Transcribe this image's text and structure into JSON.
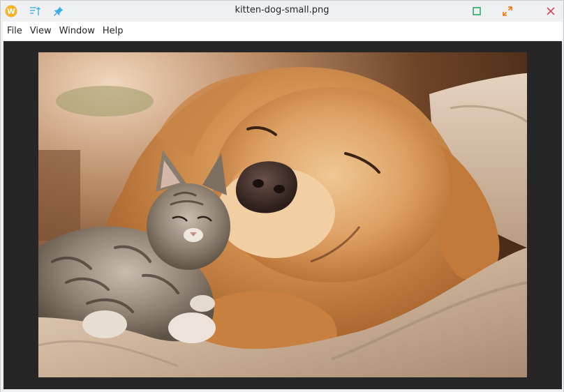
{
  "window": {
    "title": "kitten-dog-small.png"
  },
  "titlebar": {
    "app_icon": "app-logo-icon",
    "sort_icon": "sort-icon",
    "pin_icon": "pin-icon",
    "maximize_icon": "maximize-icon",
    "restore_icon": "restore-icon",
    "close_icon": "close-icon",
    "colors": {
      "app_logo": "#f5b324",
      "accent_blue": "#3daee9",
      "maximize_green": "#27ae60",
      "restore_orange": "#f67400",
      "close_red": "#da4453"
    }
  },
  "menu": {
    "items": [
      {
        "label": "File"
      },
      {
        "label": "View"
      },
      {
        "label": "Window"
      },
      {
        "label": "Help"
      }
    ]
  },
  "viewer": {
    "background": "#262626"
  }
}
